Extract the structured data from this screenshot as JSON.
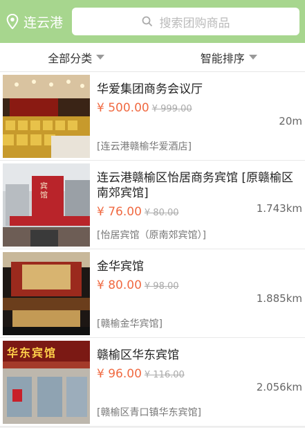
{
  "header": {
    "city": "连云港",
    "search_placeholder": "搜索团购商品",
    "colors": {
      "bar": "#a7d68e",
      "price": "#f06a42"
    }
  },
  "filters": {
    "category": "全部分类",
    "sort": "智能排序"
  },
  "items": [
    {
      "title": "华爱集团商务会议厅",
      "price": "¥ 500.00",
      "original": "¥ 999.00",
      "address": "[连云港赣榆华爱酒店]",
      "distance": "20m"
    },
    {
      "title": "连云港赣榆区怡居商务宾馆 [原赣榆区南郊宾馆]",
      "price": "¥ 76.00",
      "original": "¥ 80.00",
      "address": "[怡居宾馆（原南郊宾馆）]",
      "distance": "1.743km"
    },
    {
      "title": "金华宾馆",
      "price": "¥ 80.00",
      "original": "¥ 98.00",
      "address": "[赣榆金华宾馆]",
      "distance": "1.885km"
    },
    {
      "title": "赣榆区华东宾馆",
      "price": "¥ 96.00",
      "original": "¥ 116.00",
      "address": "[赣榆区青口镇华东宾馆]",
      "distance": "2.056km"
    }
  ],
  "signs": {
    "hotel2": "宾馆",
    "hotel4": "华东宾馆"
  }
}
